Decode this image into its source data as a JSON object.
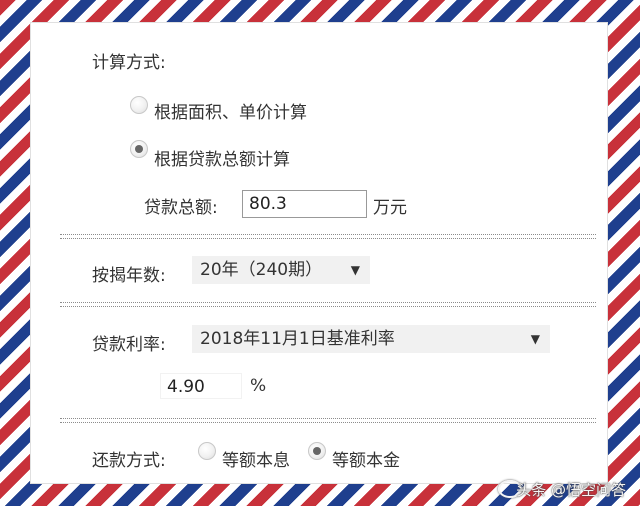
{
  "calc_method": {
    "label": "计算方式:",
    "options": [
      {
        "label": "根据面积、单价计算",
        "checked": false
      },
      {
        "label": "根据贷款总额计算",
        "checked": true
      }
    ]
  },
  "loan_total": {
    "label": "贷款总额:",
    "value": "80.3",
    "unit": "万元"
  },
  "mortgage_years": {
    "label": "按揭年数:",
    "selected": "20年（240期）"
  },
  "interest_rate": {
    "label": "贷款利率:",
    "selected": "2018年11月1日基准利率",
    "value": "4.90",
    "unit": "%"
  },
  "repayment": {
    "label": "还款方式:",
    "options": [
      {
        "label": "等额本息",
        "checked": false
      },
      {
        "label": "等额本金",
        "checked": true
      }
    ]
  },
  "watermark": {
    "text": "头条 @悟空问答"
  },
  "colors": {
    "stripe_red": "#c8313a",
    "stripe_blue": "#1f3f8e",
    "select_bg": "#f1f1f1"
  },
  "icons": {
    "dropdown": "triangle-down-icon",
    "radio": "radio-icon"
  }
}
